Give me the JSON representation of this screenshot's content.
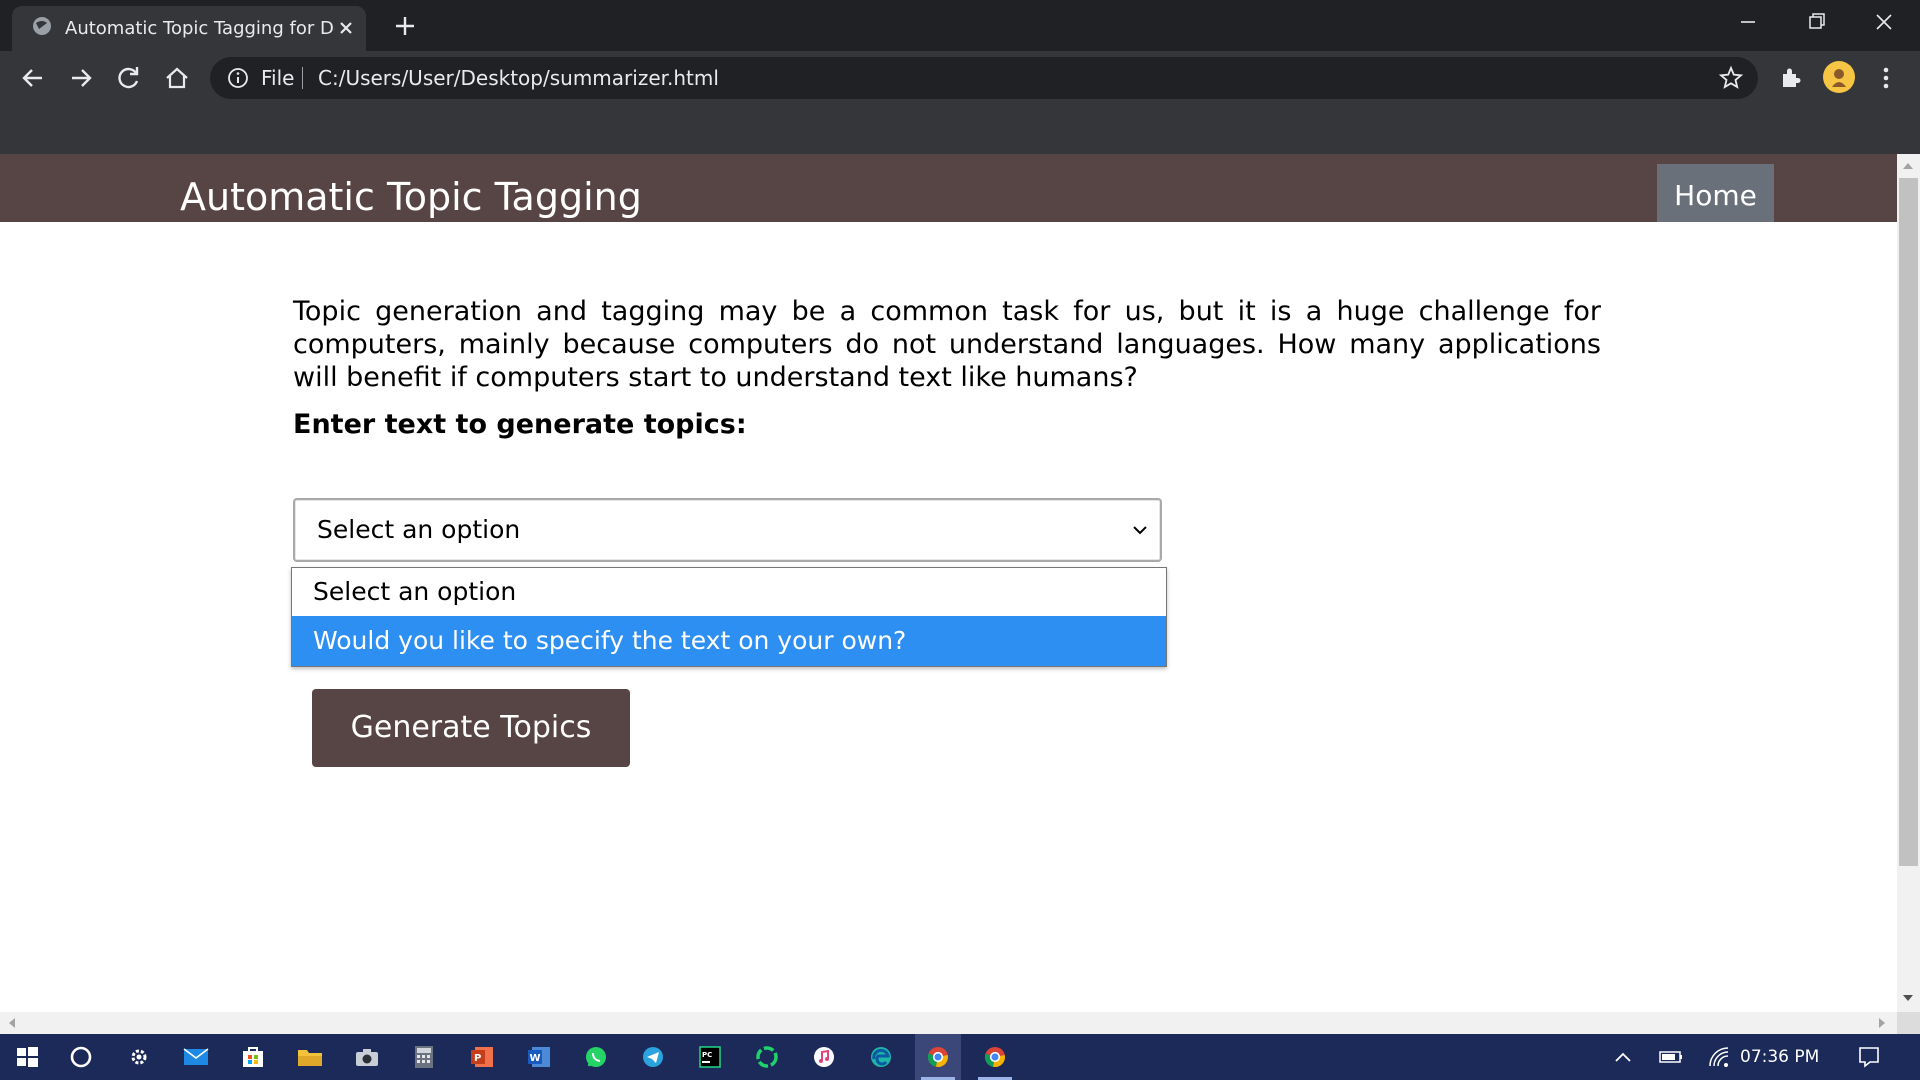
{
  "browser": {
    "tab_title": "Automatic Topic Tagging for Documents",
    "address_scheme": "File",
    "url": "C:/Users/User/Desktop/summarizer.html",
    "icons": [
      "back-arrow-icon",
      "forward-arrow-icon",
      "reload-icon",
      "home-icon",
      "info-icon",
      "star-icon",
      "extensions-icon",
      "profile-avatar",
      "menu-kebab-icon"
    ]
  },
  "page": {
    "site_title": "Automatic Topic Tagging",
    "nav_home": "Home",
    "intro": "Topic generation and tagging may be a common task for us, but it is a huge challenge for computers, mainly because computers do not understand languages. How many applications will benefit if computers start to understand text like humans?",
    "prompt_label": "Enter text to generate topics:",
    "select": {
      "value": "Select an option",
      "options": [
        "Select an option",
        "Would you like to specify the text on your own?"
      ],
      "highlighted_option": "Would you like to specify the text on your own?"
    },
    "generate_button": "Generate Topics"
  },
  "colors": {
    "header_brown": "#574444",
    "home_gray": "#6a7079",
    "option_highlight": "#2e8ff2",
    "taskbar": "#1c2a5a"
  },
  "taskbar": {
    "clock": "07:36 PM",
    "icons": [
      "windows-start-icon",
      "cortana-search-icon",
      "settings-icon",
      "mail-icon",
      "store-icon",
      "file-explorer-icon",
      "camera-icon",
      "calculator-icon",
      "powerpoint-icon",
      "word-icon",
      "whatsapp-icon",
      "telegram-icon",
      "pycharm-icon",
      "app-ring-icon",
      "itunes-icon",
      "edge-icon",
      "chrome-icon",
      "chrome-alt-icon"
    ],
    "tray_icons": [
      "show-hidden-icons-chevron",
      "battery-icon",
      "wifi-icon",
      "notification-center-icon"
    ]
  }
}
